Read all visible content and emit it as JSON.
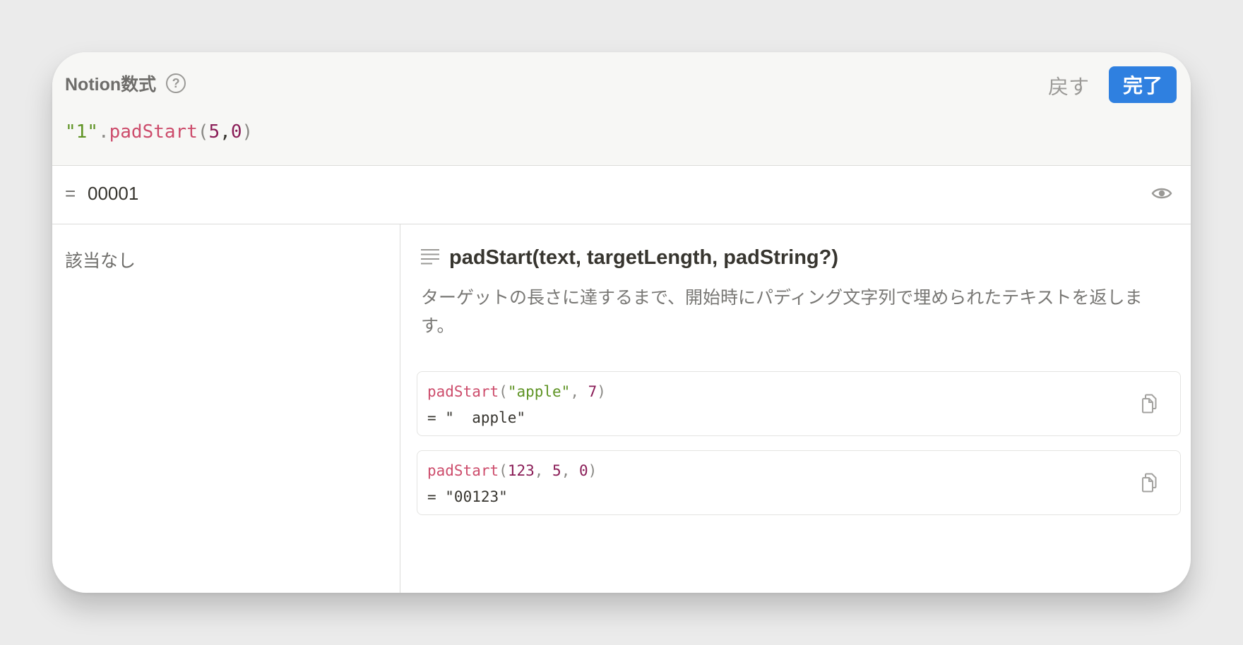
{
  "header": {
    "title": "Notion数式",
    "help_icon": "?",
    "back_label": "戻す",
    "done_label": "完了"
  },
  "formula": {
    "str": "\"1\"",
    "dot": ".",
    "fn": "padStart",
    "open": "(",
    "arg1": "5",
    "comma": ",",
    "arg2": "0",
    "close": ")"
  },
  "result": {
    "eq": "=",
    "value": "00001",
    "icon": "eye-icon"
  },
  "suggestions": {
    "empty_label": "該当なし"
  },
  "docs": {
    "icon": "text-lines-icon",
    "signature": "padStart(text, targetLength, padString?)",
    "description": "ターゲットの長さに達するまで、開始時にパディング文字列で埋められたテキストを返します。",
    "examples": [
      {
        "fn": "padStart",
        "open": "(",
        "a1": "\"apple\"",
        "sep1": ", ",
        "a2": "7",
        "close": ")",
        "result": "= \"  apple\""
      },
      {
        "fn": "padStart",
        "open": "(",
        "a1": "123",
        "sep1": ", ",
        "a2": "5",
        "sep2": ", ",
        "a3": "0",
        "close": ")",
        "result": "= \"00123\""
      }
    ],
    "copy_icon": "copy-icon"
  },
  "colors": {
    "accent": "#2f80e0",
    "string": "#5e9323",
    "function": "#cd4d6c",
    "number": "#8a1d57"
  }
}
